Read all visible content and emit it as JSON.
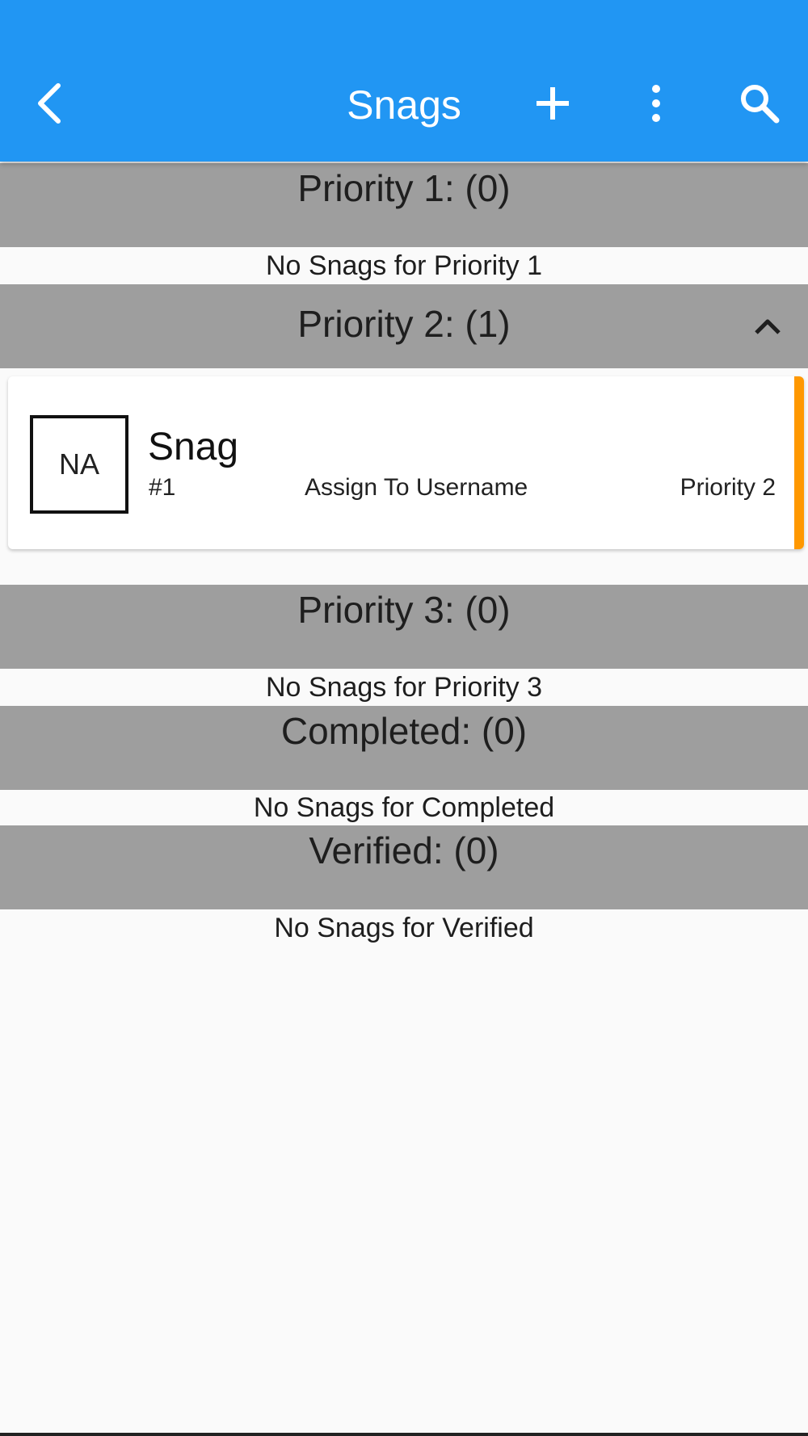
{
  "appbar": {
    "title": "Snags",
    "color": "#2196f3",
    "back_icon": "chevron-left-icon",
    "actions": [
      "add-icon",
      "more-vert-icon",
      "search-icon"
    ]
  },
  "sections": [
    {
      "label": "Priority 1: (0)",
      "empty_text": "No Snags for Priority 1"
    },
    {
      "label": "Priority 2: (1)",
      "expanded_icon": "chevron-up-icon"
    },
    {
      "label": "Priority 3: (0)",
      "empty_text": "No Snags for Priority 3"
    },
    {
      "label": "Completed: (0)",
      "empty_text": "No Snags for Completed"
    },
    {
      "label": "Verified: (0)",
      "empty_text": "No Snags for Verified"
    }
  ],
  "snag": {
    "avatar": "NA",
    "name": "Snag",
    "number": "#1",
    "assignee": "Assign To Username",
    "priority": "Priority 2",
    "accent_color": "#ff9800"
  },
  "colors": {
    "section_header": "#9e9e9e",
    "background": "#fafafa"
  }
}
